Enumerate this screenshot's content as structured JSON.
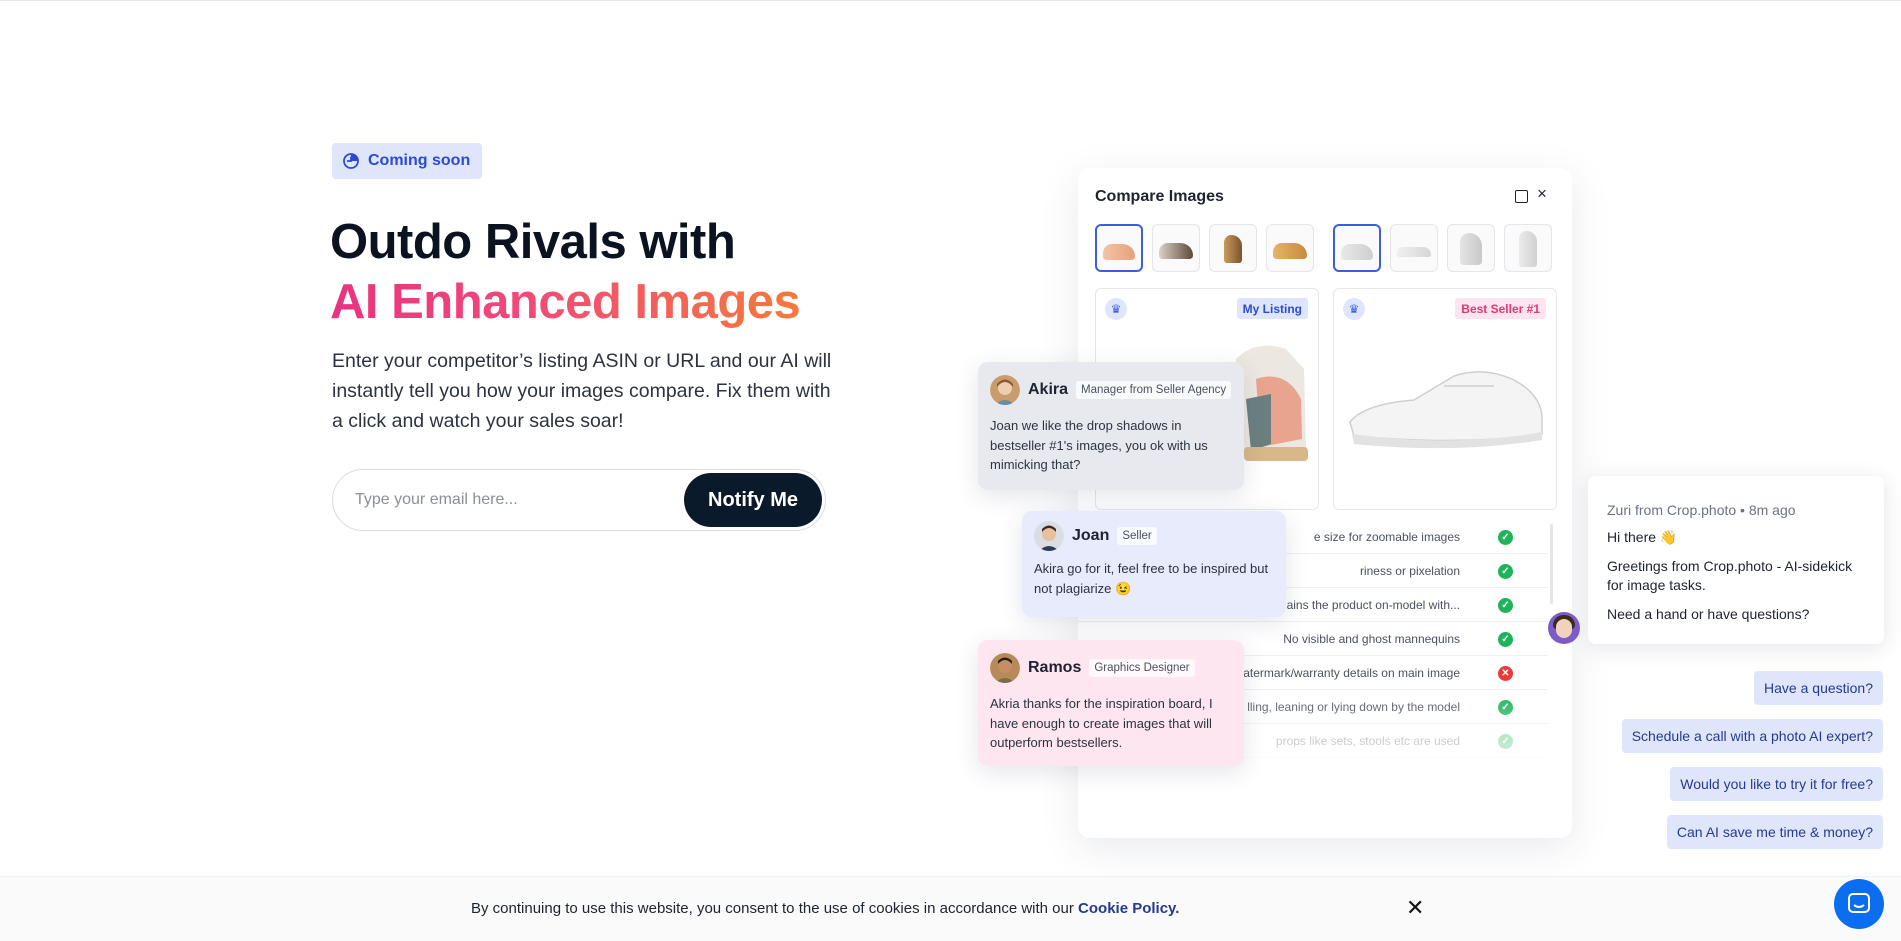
{
  "hero": {
    "badge": "Coming soon",
    "title_line1": "Outdo Rivals with",
    "title_line2": "AI Enhanced Images",
    "description": "Enter your competitor’s listing ASIN or URL and our AI will instantly tell you how your images compare. Fix them with a click and watch your sales soar!",
    "email_placeholder": "Type your email here...",
    "notify_label": "Notify Me"
  },
  "compare": {
    "title": "Compare Images",
    "my_listing_label": "My Listing",
    "best_seller_label": "Best Seller #1",
    "checks": [
      {
        "text": "e size for zoomable images",
        "status": "pass"
      },
      {
        "text": "riness or pixelation",
        "status": "pass"
      },
      {
        "text": "ains the product on-model with...",
        "status": "pass"
      },
      {
        "text": "No visible and ghost mannequins",
        "status": "pass"
      },
      {
        "text": "/watermark/warranty details on main image",
        "status": "fail"
      },
      {
        "text": "lling, leaning or lying down by the model",
        "status": "pass"
      },
      {
        "text": "props like sets, stools etc are used",
        "status": "pass"
      }
    ]
  },
  "chats": [
    {
      "name": "Akira",
      "role": "Manager from Seller Agency",
      "text": "Joan we like the drop shadows in bestseller #1's images, you ok with us mimicking that?"
    },
    {
      "name": "Joan",
      "role": "Seller",
      "text": "Akira go for it, feel free to be inspired but not plagiarize 😉"
    },
    {
      "name": "Ramos",
      "role": "Graphics Designer",
      "text": "Akria thanks for the inspiration board, I have enough to create images that will outperform bestsellers."
    }
  ],
  "zuri": {
    "meta": "Zuri from Crop.photo • 8m ago",
    "greeting": "Hi there 👋",
    "intro": "Greetings from Crop.photo - AI-sidekick for image tasks.",
    "question": "Need a hand or have questions?",
    "quick_replies": [
      "Have a question?",
      "Schedule a call with a photo AI expert?",
      "Would you like to try it for free?",
      "Can AI save me time & money?"
    ]
  },
  "cookie": {
    "text": "By continuing to use this website, you consent to the use of cookies in accordance with our",
    "link": "Cookie Policy."
  },
  "colors": {
    "accent_blue": "#2b4bd1",
    "gradient_start": "#e9337f",
    "gradient_end": "#f5793a",
    "button_dark": "#0b1a2b",
    "pass_green": "#1fb35a",
    "fail_red": "#ea3a3a"
  }
}
